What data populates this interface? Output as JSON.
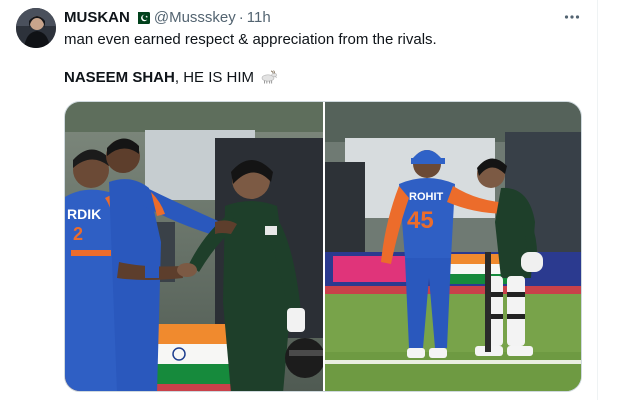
{
  "author": {
    "name": "MUSKAN",
    "flag_icon": "pakistan-flag-icon",
    "handle": "@Mussskey",
    "separator": "·",
    "time": "11h"
  },
  "more_icon": "ellipsis-icon",
  "tweet": {
    "line1": "man even earned respect & appreciation from the rivals.",
    "line2_bold": "NASEEM SHAH",
    "line2_rest": ", HE IS HIM",
    "emoji_icon": "goat-icon"
  },
  "media": {
    "left_jersey_text": "RDIK",
    "left_jersey_number": "2",
    "right_jersey_name": "ROHIT",
    "right_jersey_number": "45"
  },
  "colors": {
    "text_primary": "#0f1419",
    "text_secondary": "#536471",
    "border": "#cfd9de",
    "india_blue": "#2f5fc4",
    "india_orange": "#f07a2a",
    "pakistan_green": "#1e3f2a"
  }
}
